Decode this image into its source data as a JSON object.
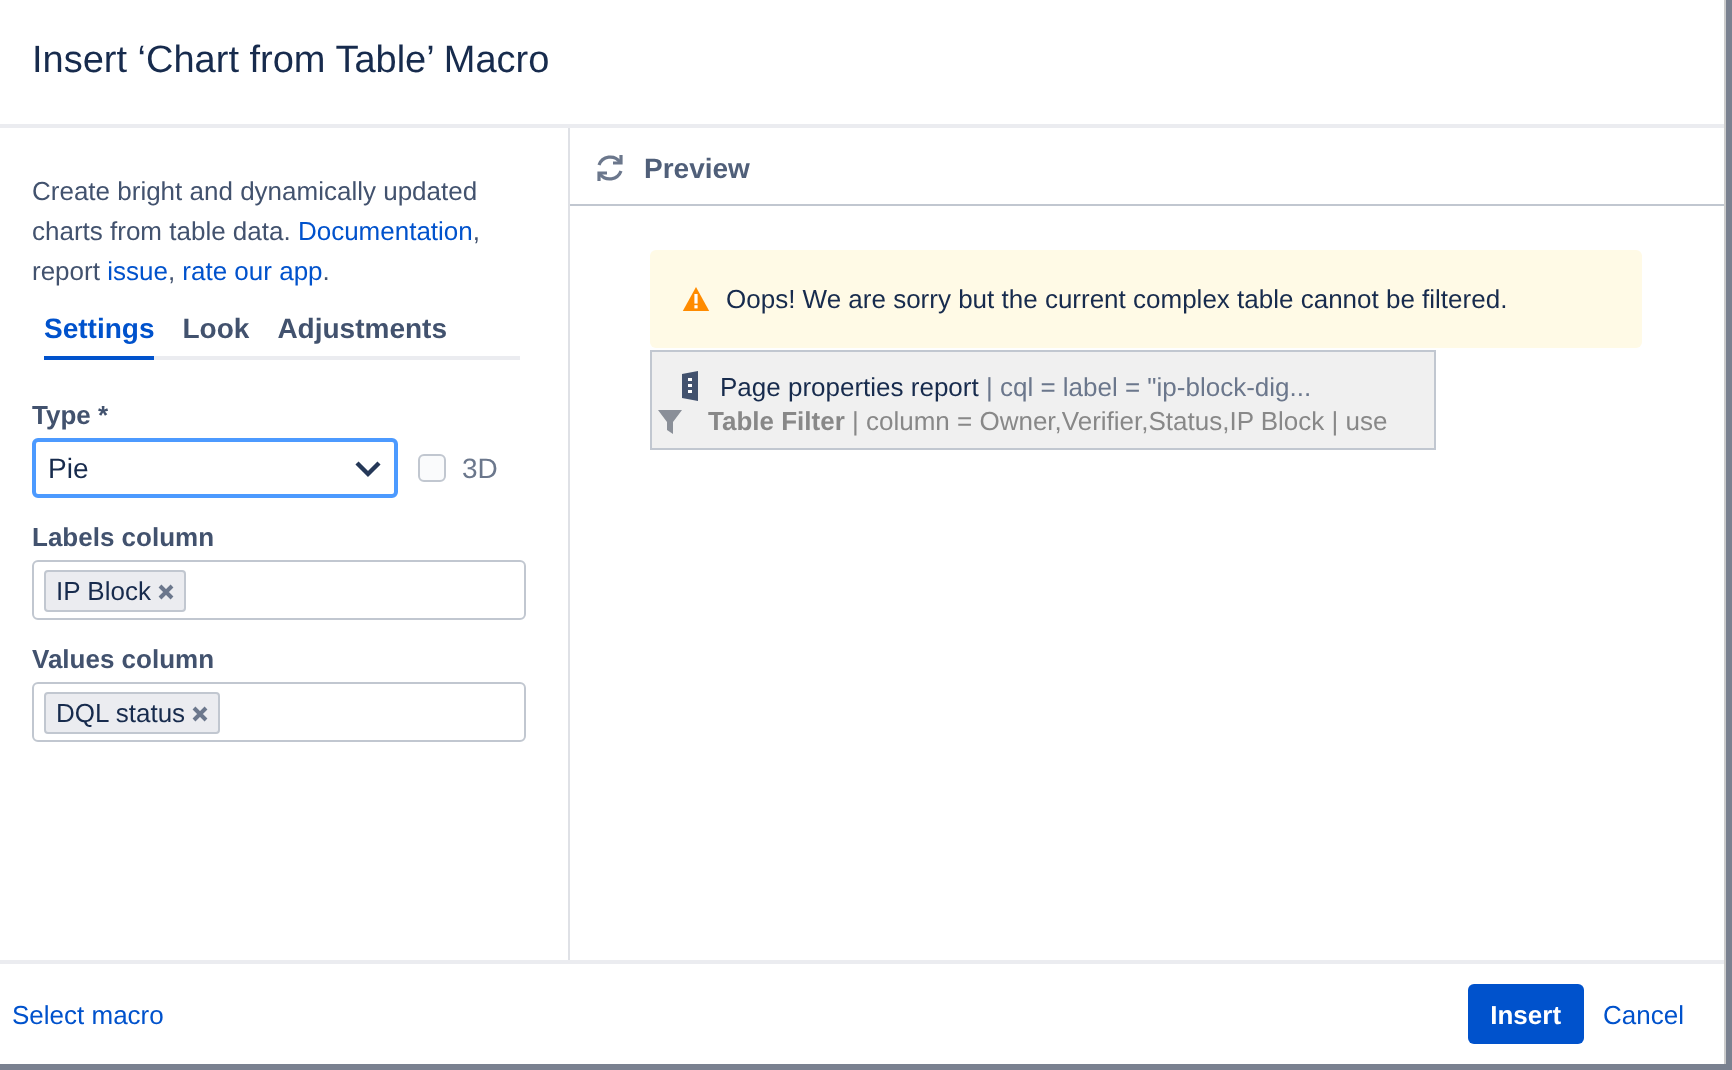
{
  "dialog": {
    "title": "Insert ‘Chart from Table’ Macro"
  },
  "intro": [
    {
      "kind": "text",
      "text": "Create bright and dynamically updated charts from table data. "
    },
    {
      "kind": "link",
      "text": "Documentation"
    },
    {
      "kind": "text",
      "text": ", report "
    },
    {
      "kind": "link",
      "text": "issue"
    },
    {
      "kind": "text",
      "text": ", "
    },
    {
      "kind": "link",
      "text": "rate our app"
    },
    {
      "kind": "text",
      "text": "."
    }
  ],
  "tabs": [
    {
      "label": "Settings",
      "selected": true
    },
    {
      "label": "Look",
      "selected": false
    },
    {
      "label": "Adjustments",
      "selected": false
    }
  ],
  "type_field": {
    "label": "Type *",
    "value": "Pie",
    "focused": true
  },
  "three_d": {
    "label": "3D",
    "checked": false
  },
  "labels_column": {
    "label": "Labels column",
    "tags": [
      "IP Block"
    ]
  },
  "values_column": {
    "label": "Values column",
    "tags": [
      "DQL status"
    ]
  },
  "preview": {
    "title": "Preview",
    "warning": "Oops! We are sorry but the current complex table cannot be filtered.",
    "macros": [
      {
        "name": "Page properties report",
        "params": "| cql = label = \"ip-block-dig..."
      },
      {
        "name": "Table Filter",
        "params": "| column = Owner,Verifier,Status,IP Block | use"
      }
    ]
  },
  "footer": {
    "link": "Select macro",
    "primary": "Insert",
    "cancel": "Cancel"
  }
}
